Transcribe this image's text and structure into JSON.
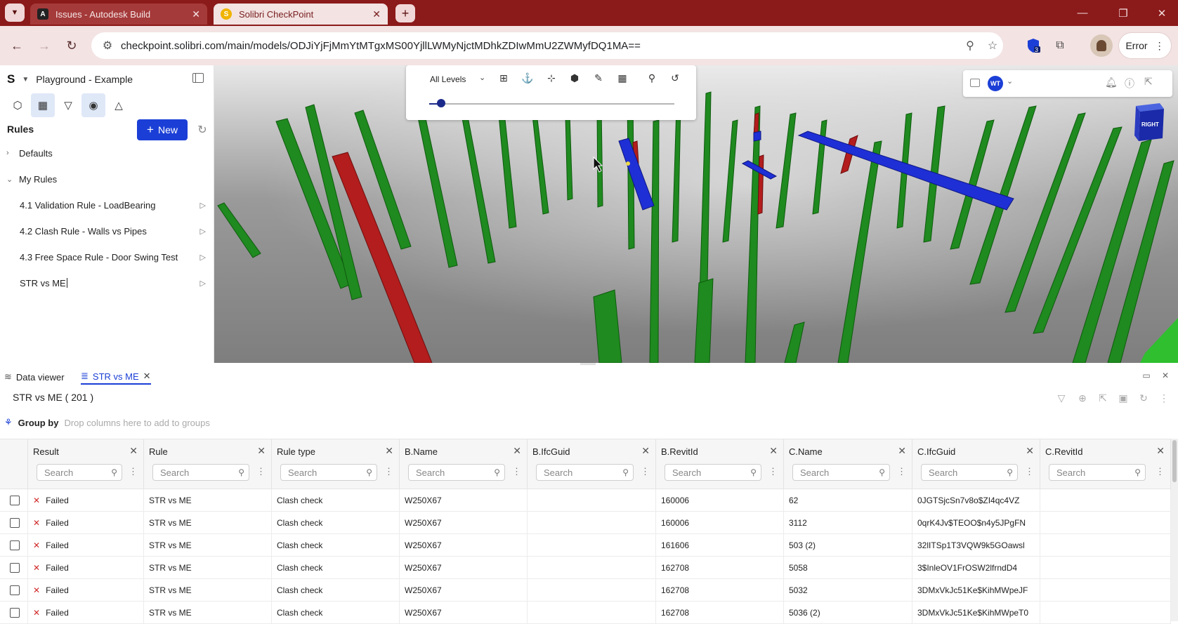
{
  "browser": {
    "tabs": [
      {
        "title": "Issues - Autodesk Build",
        "fav": "A"
      },
      {
        "title": "Solibri CheckPoint",
        "fav": "S"
      }
    ],
    "url": "checkpoint.solibri.com/main/models/ODJiYjFjMmYtMTgxMS00YjllLWMyNjctMDhkZDIwMmU2ZWMyfDQ1MA==",
    "extension_badge": "3",
    "error_label": "Error"
  },
  "app": {
    "logo": "S",
    "project_name": "Playground - Example",
    "rules_title": "Rules",
    "new_button": "New",
    "tree": {
      "defaults": "Defaults",
      "my_rules": "My Rules",
      "rules": [
        "4.1 Validation Rule - LoadBearing",
        "4.2 Clash Rule - Walls vs Pipes",
        "4.3 Free Space Rule - Door Swing Test",
        "STR vs ME"
      ]
    }
  },
  "viewer": {
    "level_select": "All Levels",
    "level_slider": 0.05,
    "avatar_initials": "WT",
    "viewcube_face": "RIGHT"
  },
  "bottom": {
    "tabs": {
      "data_viewer": "Data viewer",
      "rule": "STR vs ME"
    },
    "count_title": "STR vs ME ( 201 )",
    "group_by_label": "Group by",
    "group_by_hint": "Drop columns here to add to groups",
    "search_placeholder": "Search",
    "columns": [
      "Result",
      "Rule",
      "Rule type",
      "B.Name",
      "B.IfcGuid",
      "B.RevitId",
      "C.Name",
      "C.IfcGuid",
      "C.RevitId"
    ],
    "rows": [
      [
        "Failed",
        "STR vs ME",
        "Clash check",
        "W250X67",
        "",
        "160006",
        "62",
        "0JGTSjcSn7v8o$ZI4qc4VZ",
        ""
      ],
      [
        "Failed",
        "STR vs ME",
        "Clash check",
        "W250X67",
        "",
        "160006",
        "3112",
        "0qrK4Jv$TEOO$n4y5JPgFN",
        ""
      ],
      [
        "Failed",
        "STR vs ME",
        "Clash check",
        "W250X67",
        "",
        "161606",
        "503 (2)",
        "32lITSp1T3VQW9k5GOawsl",
        ""
      ],
      [
        "Failed",
        "STR vs ME",
        "Clash check",
        "W250X67",
        "",
        "162708",
        "5058",
        "3$InleOV1FrOSW2lfrndD4",
        ""
      ],
      [
        "Failed",
        "STR vs ME",
        "Clash check",
        "W250X67",
        "",
        "162708",
        "5032",
        "3DMxVkJc51Ke$KihMWpeJF",
        ""
      ],
      [
        "Failed",
        "STR vs ME",
        "Clash check",
        "W250X67",
        "",
        "162708",
        "5036 (2)",
        "3DMxVkJc51Ke$KihMWpeT0",
        ""
      ]
    ]
  }
}
